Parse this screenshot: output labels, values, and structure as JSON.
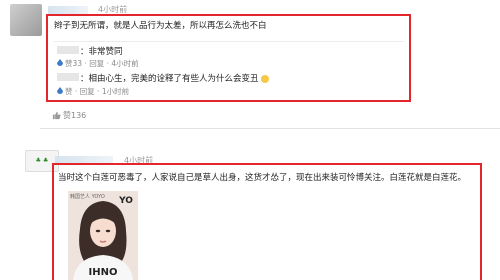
{
  "comment1": {
    "time": "4小时前",
    "text": "辫子到无所谓，就是人品行为太差，所以再怎么洗也不白",
    "replies": [
      {
        "text": "：非常赞同",
        "likes": "赞33",
        "reply_label": "回复",
        "time": "4小时前"
      },
      {
        "text": "：相由心生，完美的诠释了有些人为什么会变丑",
        "likes": "赞",
        "reply_label": "回复",
        "time": "1小时前"
      }
    ],
    "like_count": "赞136"
  },
  "comment2": {
    "time": "4小时前",
    "text": "当时这个白莲可恶毒了，人家说自己是草人出身，这货才怂了，现在出来装可怜博关注。白莲花就是白莲花。",
    "photo_caption": "韩国艺人 YOYO"
  },
  "colors": {
    "highlight": "#e3262b",
    "link": "#3d7ac8",
    "muted": "#999999"
  }
}
